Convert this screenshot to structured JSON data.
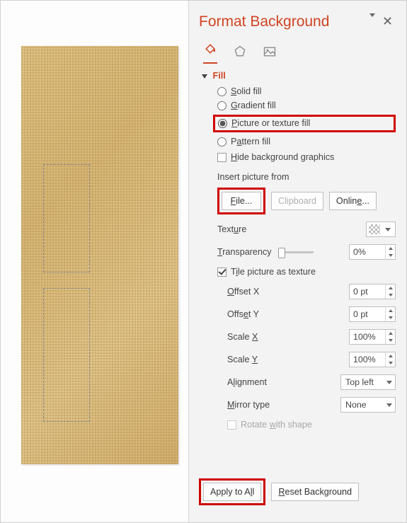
{
  "panel": {
    "title": "Format Background",
    "section_fill": "Fill",
    "radios": {
      "solid": "Solid fill",
      "gradient": "Gradient fill",
      "picture": "Picture or texture fill",
      "pattern": "Pattern fill"
    },
    "hide_bg": "Hide background graphics",
    "insert_from": "Insert picture from",
    "buttons": {
      "file": "File...",
      "clipboard": "Clipboard",
      "online": "Online..."
    },
    "texture_label": "Texture",
    "transparency_label": "Transparency",
    "transparency_value": "0%",
    "tile_label": "Tile picture as texture",
    "offset_x_label": "Offset X",
    "offset_x_value": "0 pt",
    "offset_y_label": "Offset Y",
    "offset_y_value": "0 pt",
    "scale_x_label": "Scale X",
    "scale_x_value": "100%",
    "scale_y_label": "Scale Y",
    "scale_y_value": "100%",
    "alignment_label": "Alignment",
    "alignment_value": "Top left",
    "mirror_label": "Mirror type",
    "mirror_value": "None",
    "rotate_label": "Rotate with shape",
    "apply_all": "Apply to All",
    "reset": "Reset Background"
  }
}
